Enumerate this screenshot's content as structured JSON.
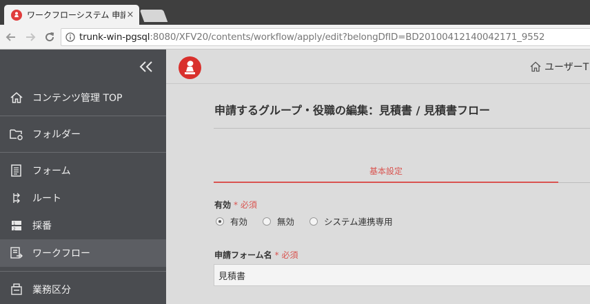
{
  "browser": {
    "tab_title": "ワークフローシステム 申請する",
    "tab_close": "×",
    "url_host": "trunk-win-pgsql",
    "url_path": ":8080/XFV20/contents/workflow/apply/edit?belongDfID=BD20100412140042171_9552"
  },
  "sidebar": {
    "collapse_glyph": "«",
    "items": [
      {
        "label": "コンテンツ管理 TOP",
        "icon": "home-icon"
      },
      {
        "label": "フォルダー",
        "icon": "folder-settings-icon"
      },
      {
        "label": "フォーム",
        "icon": "form-icon"
      },
      {
        "label": "ルート",
        "icon": "route-icon"
      },
      {
        "label": "採番",
        "icon": "numbering-icon"
      },
      {
        "label": "ワークフロー",
        "icon": "workflow-icon"
      },
      {
        "label": "業務区分",
        "icon": "business-category-icon"
      }
    ]
  },
  "header": {
    "home_label": "ユーザーT"
  },
  "page": {
    "title": "申請するグループ・役職の編集：見積書 / 見積書フロー",
    "tab_basic": "基本設定",
    "enabled_label": "有効",
    "required_mark": "* 必須",
    "radio_options": [
      "有効",
      "無効",
      "システム連携専用"
    ],
    "radio_selected": "有効",
    "form_name_label": "申請フォーム名",
    "form_name_value": "見積書"
  },
  "colors": {
    "accent": "#d9534f",
    "sidebar_bg": "#4a4c50"
  }
}
